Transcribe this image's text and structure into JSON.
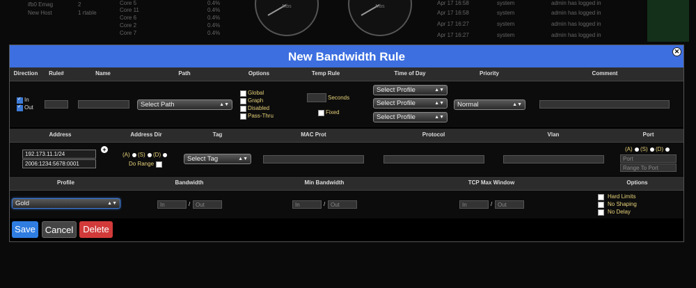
{
  "background": {
    "rows": [
      {
        "c1": "ifb0 Emag",
        "c2": "2",
        "c3": "Core 5",
        "c4": "0.4%",
        "c5": "Apr 17 16:58",
        "c6": "system",
        "c7": "admin has logged in"
      },
      {
        "c1": "New Host",
        "c2": "1 rtable",
        "c3": "Core 11",
        "c4": "0.4%",
        "c5": "Apr 17 16:58",
        "c6": "system",
        "c7": "admin has logged in"
      },
      {
        "c1": "",
        "c2": "",
        "c3": "Core 6",
        "c4": "0.4%",
        "c5": "Apr 17 16:27",
        "c6": "system",
        "c7": "admin has logged in"
      },
      {
        "c1": "",
        "c2": "",
        "c3": "Core 2",
        "c4": "0.4%",
        "c5": "Apr 17 16:27",
        "c6": "system",
        "c7": "admin has logged in"
      },
      {
        "c1": "",
        "c2": "",
        "c3": "Core 7",
        "c4": "0.4%",
        "c5": "",
        "c6": "",
        "c7": ""
      }
    ],
    "gauge_labels": [
      "Mbs",
      "Mbs"
    ]
  },
  "dialog": {
    "title": "New Bandwidth Rule",
    "close_icon": "✕"
  },
  "section1": {
    "headers": [
      "Direction",
      "Rule#",
      "Name",
      "Path",
      "Options",
      "Temp Rule",
      "Time of Day",
      "Priority",
      "Comment"
    ],
    "direction": {
      "in_label": "In",
      "out_label": "Out",
      "in_checked": true,
      "out_checked": true
    },
    "path_select": "Select Path",
    "options": [
      "Global",
      "Graph",
      "Disabled",
      "Pass-Thru"
    ],
    "temp_rule": {
      "seconds_label": "Seconds",
      "fixed_label": "Fixed"
    },
    "time_of_day": [
      "Select Profile",
      "Select Profile",
      "Select Profile"
    ],
    "priority": "Normal"
  },
  "section2": {
    "headers": [
      "Address",
      "Address Dir",
      "Tag",
      "MAC Prot",
      "Protocol",
      "Vlan",
      "Port"
    ],
    "addresses": [
      "192.173.11.1/24",
      "2006:1234:5678:0001"
    ],
    "add_icon": "+",
    "addr_dir": {
      "a": "(A)",
      "s": "(S)",
      "d": "(D)",
      "range": "Do Range"
    },
    "tag_select": "Select Tag",
    "port": {
      "a": "(A)",
      "s": "(S)",
      "d": "(D)",
      "port_placeholder": "Port",
      "range_placeholder": "Range To Port"
    }
  },
  "section3": {
    "headers": [
      "Profile",
      "Bandwidth",
      "Min Bandwidth",
      "TCP Max Window",
      "Options"
    ],
    "profile": "Gold",
    "in_placeholder": "In",
    "out_placeholder": "Out",
    "slash": "/",
    "options": [
      "Hard Limits",
      "No Shaping",
      "No Delay"
    ]
  },
  "buttons": {
    "save": "Save",
    "cancel": "Cancel",
    "delete": "Delete"
  },
  "colors": {
    "title_bar": "#3d6fe0",
    "save": "#2f7de1",
    "cancel": "#444444",
    "delete": "#d23a3a",
    "label_accent": "#e8d27a"
  }
}
